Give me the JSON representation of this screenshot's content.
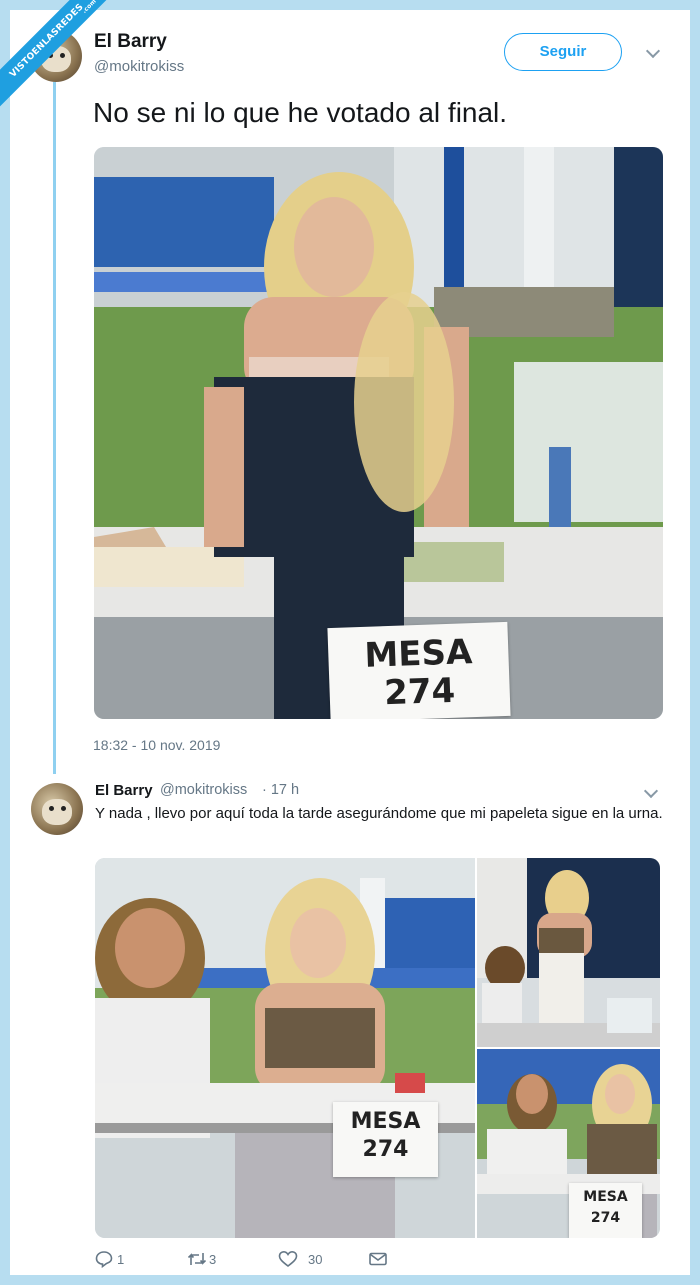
{
  "watermark": {
    "text": "VISTOENLASREDES",
    "suffix": ".com"
  },
  "main_tweet": {
    "author_name": "El Barry",
    "author_handle": "@mokitrokiss",
    "follow_label": "Seguir",
    "text": "No se ni lo que he votado al final.",
    "timestamp": "18:32 - 10 nov. 2019",
    "image_sign": {
      "line1": "MESA",
      "line2": "274"
    }
  },
  "reply_tweet": {
    "author_name": "El Barry",
    "author_handle": "@mokitrokiss",
    "age": "· 17 h",
    "text": "Y nada , llevo por aquí toda la tarde asegurándome que mi papeleta sigue en la urna.",
    "image_sign": {
      "line1": "MESA",
      "line2": "274"
    },
    "small_sign": {
      "line1": "MESA",
      "line2": "274"
    },
    "actions": {
      "replies": "1",
      "retweets": "3",
      "likes": "30"
    }
  },
  "colors": {
    "accent": "#1da1f2",
    "frame": "#b7ddf0",
    "muted": "#657786"
  },
  "icons": [
    "reply-icon",
    "retweet-icon",
    "like-icon",
    "message-icon",
    "chevron-down-icon"
  ]
}
